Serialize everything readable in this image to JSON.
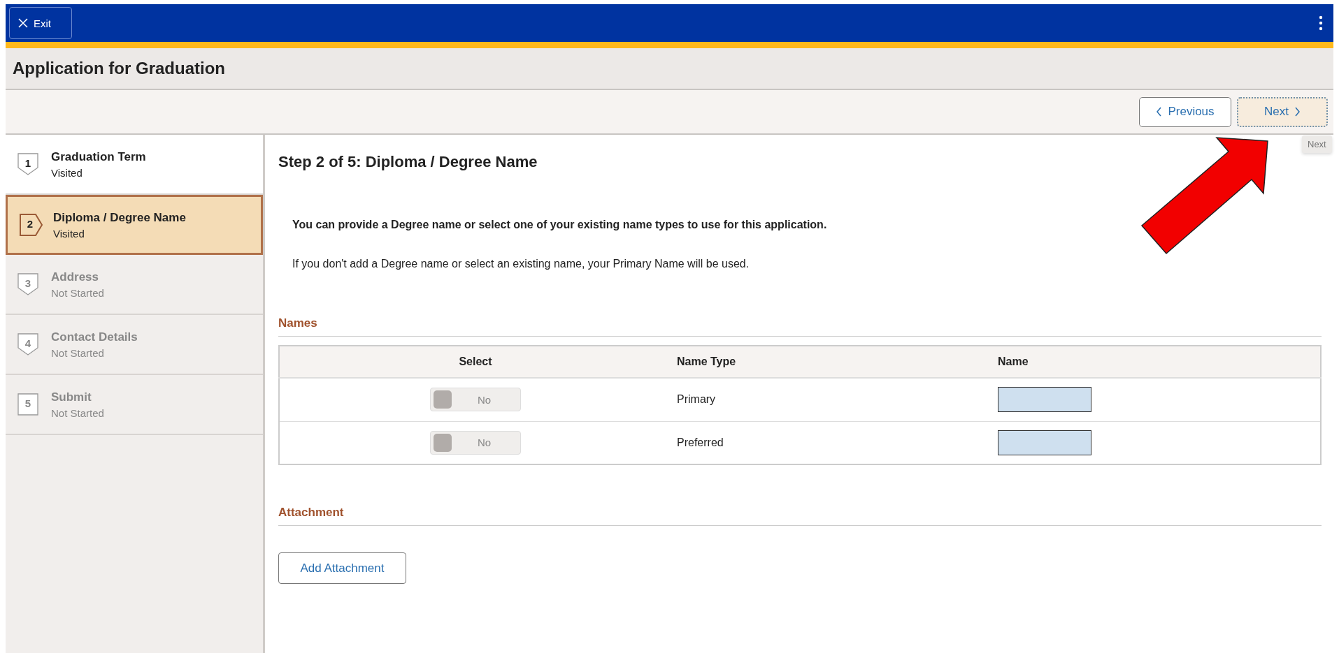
{
  "header": {
    "exit_button": "Exit"
  },
  "page_title": "Application for Graduation",
  "nav_buttons": {
    "previous": "Previous",
    "next": "Next",
    "next_focused": true
  },
  "tooltip": "Next",
  "steps": [
    {
      "number": "1",
      "label": "Graduation Term",
      "status": "Visited",
      "visited": true,
      "selected": false
    },
    {
      "number": "2",
      "label": "Diploma / Degree Name",
      "status": "Visited",
      "visited": true,
      "selected": true
    },
    {
      "number": "3",
      "label": "Address",
      "status": "Not Started",
      "visited": false,
      "selected": false
    },
    {
      "number": "4",
      "label": "Contact Details",
      "status": "Not Started",
      "visited": false,
      "selected": false
    },
    {
      "number": "5",
      "label": "Submit",
      "status": "Not Started",
      "visited": false,
      "selected": false
    }
  ],
  "content": {
    "heading": "Step 2 of 5: Diploma / Degree Name",
    "intro": "You can provide a Degree name or select one of your existing name types to use for this application.",
    "note": "If you don't add a Degree name or select an existing name, your Primary Name will be used."
  },
  "names": {
    "title": "Names",
    "columns": [
      "Select",
      "Name Type",
      "Name"
    ],
    "rows": [
      {
        "select_label": "No",
        "on": false,
        "name_type": "Primary"
      },
      {
        "select_label": "No",
        "on": false,
        "name_type": "Preferred"
      }
    ]
  },
  "attachment": {
    "title": "Attachment",
    "button": "Add Attachment"
  }
}
